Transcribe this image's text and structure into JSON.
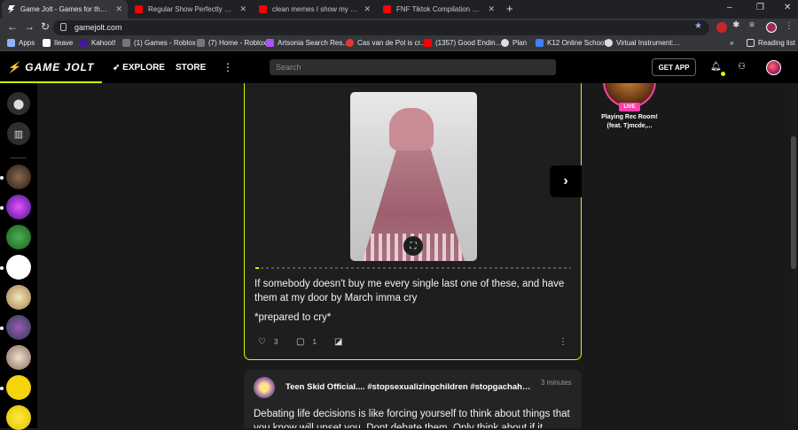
{
  "browser": {
    "tabs": [
      {
        "title": "Game Jolt - Games for the love of",
        "icon": "gamejolt-icon",
        "active": true
      },
      {
        "title": "Regular Show Perfectly Cut Part",
        "icon": "youtube-icon"
      },
      {
        "title": "clean memes I show my pet duck",
        "icon": "youtube-icon"
      },
      {
        "title": "FNF Tiktok Compilation #12 | Fri",
        "icon": "youtube-icon"
      }
    ],
    "new_tab": "+",
    "window_controls": [
      "–",
      "❐",
      "✕"
    ],
    "url": "gamejolt.com",
    "bookmarks": [
      {
        "label": "Apps",
        "color": "#8ab4f8"
      },
      {
        "label": "Ileave",
        "color": "#ffffff"
      },
      {
        "label": "Kahoot!",
        "color": "#46178f"
      },
      {
        "label": "(1) Games - Roblox",
        "color": "#cccccc"
      },
      {
        "label": "(7) Home - Roblox",
        "color": "#cccccc"
      },
      {
        "label": "Artsonia Search Res...",
        "color": "#a855f7"
      },
      {
        "label": "Cas van de Pol is cr...",
        "color": "#e53935"
      },
      {
        "label": "(1357) Good Endin...",
        "color": "#ff0000"
      },
      {
        "label": "Plan",
        "color": "#dddddd"
      },
      {
        "label": "K12 Online School",
        "color": "#3b82f6"
      },
      {
        "label": "Virtual Instrument:...",
        "color": "#dddddd"
      }
    ],
    "overflow": "»",
    "reading_list": "Reading list"
  },
  "header": {
    "logo": "GAME JOLT",
    "nav": [
      "EXPLORE",
      "STORE"
    ],
    "search_placeholder": "Search",
    "get_app": "GET APP"
  },
  "feed": {
    "post1": {
      "text": "If somebody doesn't buy me every single last one of these, and have them at my door by March imma cry",
      "text2": "*prepared to cry*",
      "likes": "3",
      "comments": "1",
      "progress_fraction": 0.01
    },
    "post2": {
      "title": "Teen Skid Official.... #stopsexualizingchildren #stopgachahate #st...",
      "time": "3 minutes",
      "text": "Debating life decisions is like forcing yourself to think about things that you know will upset you. Dont debate them. Only think about if it"
    }
  },
  "live": {
    "badge": "LIVE",
    "title": "Playing Rec Room!",
    "subtitle": "(feat. Tjmcde,..."
  },
  "colors": {
    "accent": "#ccff00",
    "live": "#ff3fac"
  }
}
